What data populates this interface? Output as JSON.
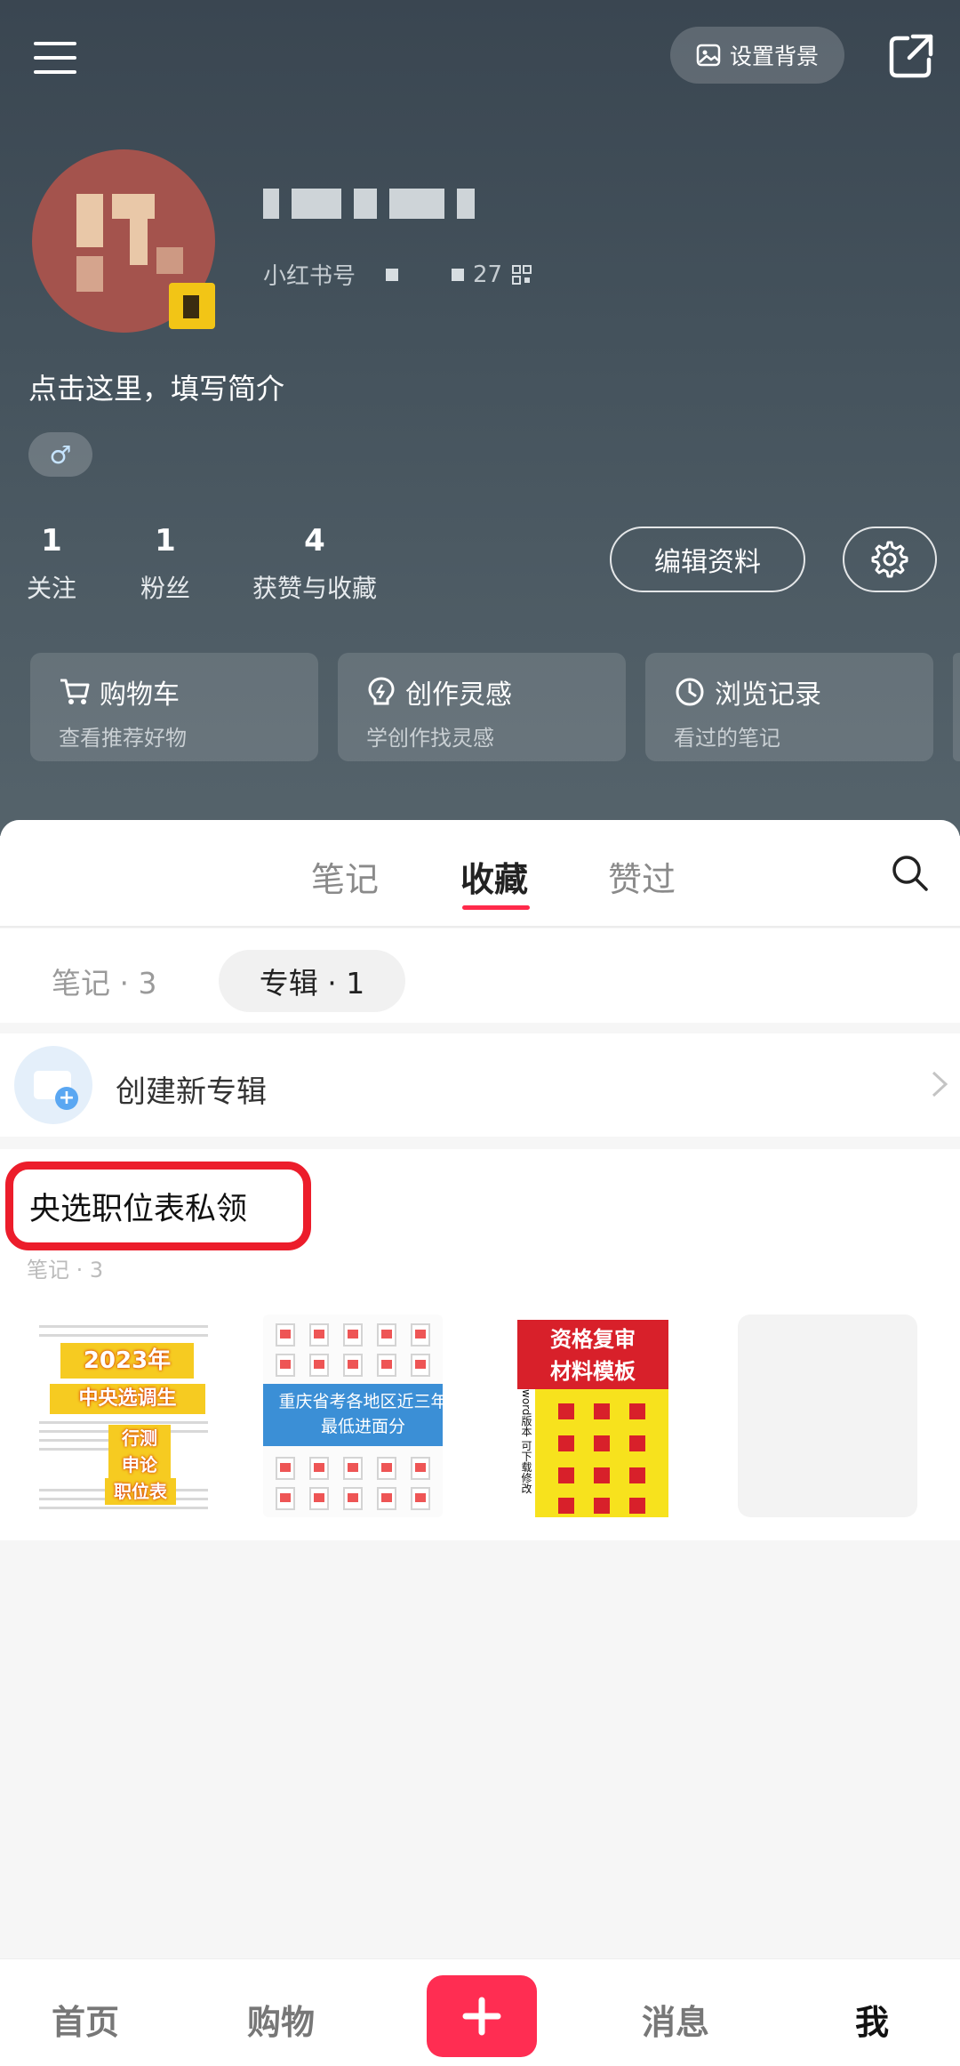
{
  "header": {
    "set_background_label": "设置背景",
    "rednote_id_prefix": "小红书号",
    "rednote_id_suffix": "27",
    "bio": "点击这里，填写简介",
    "gender": "♂"
  },
  "stats": [
    {
      "value": "1",
      "label": "关注"
    },
    {
      "value": "1",
      "label": "粉丝"
    },
    {
      "value": "4",
      "label": "获赞与收藏"
    }
  ],
  "edit_profile_label": "编辑资料",
  "shortcut_cards": [
    {
      "title": "购物车",
      "subtitle": "查看推荐好物",
      "icon": "cart-icon"
    },
    {
      "title": "创作灵感",
      "subtitle": "学创作找灵感",
      "icon": "bulb-icon"
    },
    {
      "title": "浏览记录",
      "subtitle": "看过的笔记",
      "icon": "clock-icon"
    }
  ],
  "tabs": [
    "笔记",
    "收藏",
    "赞过"
  ],
  "active_tab": "收藏",
  "subtabs": {
    "notes": "笔记 · 3",
    "albums": "专辑 · 1"
  },
  "create_album_label": "创建新专辑",
  "album": {
    "title": "央选职位表私领",
    "subtitle": "笔记 · 3"
  },
  "thumbnails": {
    "t1": {
      "line1": "2023年",
      "line2": "中央选调生",
      "line3": "行测",
      "line4": "申论",
      "line5": "职位表"
    },
    "t2": {
      "line1": "重庆省考各地区近三年",
      "line2": "最低进面分"
    },
    "t3": {
      "line1": "资格复审",
      "line2": "材料模板",
      "side": "word版本 可下载修改"
    }
  },
  "bottom_nav": {
    "home": "首页",
    "shop": "购物",
    "messages": "消息",
    "me": "我"
  },
  "colors": {
    "accent": "#ff2d52",
    "highlight_box": "#ec1d2b",
    "header_bg": "#44525c"
  }
}
